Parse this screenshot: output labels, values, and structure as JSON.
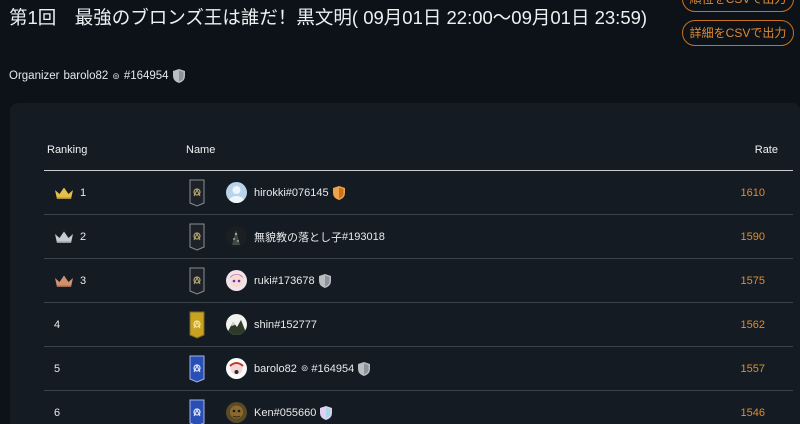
{
  "header": {
    "title": "第1回　最強のブロンズ王は誰だ！黒文明( 09月01日 22:00〜09月01日 23:59)",
    "csv_button_top": "順位をCSVで出力",
    "csv_button_detail": "詳細をCSVで出力"
  },
  "organizer": {
    "label": "Organizer",
    "name": "barolo82",
    "pin": "⊚",
    "id": "#164954",
    "shield": "silver-shield-icon"
  },
  "table": {
    "columns": {
      "ranking": "Ranking",
      "name": "Name",
      "rate": "Rate"
    },
    "rows": [
      {
        "rank": "1",
        "crown": "gold-crown-icon",
        "banner": "dark-banner-icon",
        "avatar": "default-avatar-icon",
        "name": "hirokki",
        "pin": "",
        "id": "#076145",
        "shield": "orange-shield-icon",
        "rate": "1610"
      },
      {
        "rank": "2",
        "crown": "silver-crown-icon",
        "banner": "dark-banner-icon",
        "avatar": "dark-avatar",
        "name": "無貌教の落とし子",
        "pin": "",
        "id": "#193018",
        "shield": "",
        "rate": "1590"
      },
      {
        "rank": "3",
        "crown": "bronze-crown-icon",
        "banner": "dark-banner-icon",
        "avatar": "anime-avatar",
        "name": "ruki",
        "pin": "",
        "id": "#173678",
        "shield": "silver-shield-icon",
        "rate": "1575"
      },
      {
        "rank": "4",
        "crown": "",
        "banner": "gold-banner-icon",
        "avatar": "mountain-avatar",
        "name": "shin",
        "pin": "",
        "id": "#152777",
        "shield": "",
        "rate": "1562"
      },
      {
        "rank": "5",
        "crown": "",
        "banner": "blue-banner-icon",
        "avatar": "character-avatar",
        "name": "barolo82",
        "pin": "⊚",
        "id": "#164954",
        "shield": "silver-shield-icon",
        "rate": "1557"
      },
      {
        "rank": "6",
        "crown": "",
        "banner": "blue-banner-icon",
        "avatar": "creature-avatar",
        "name": "Ken",
        "pin": "",
        "id": "#055660",
        "shield": "pastel-shield-icon",
        "rate": "1546"
      }
    ]
  },
  "colors": {
    "background": "#0c1218",
    "panel": "#141b22",
    "accent": "#e58a2c",
    "gold": "#e3bf4a",
    "silver": "#c7cbcf",
    "bronze": "#d29070",
    "blue_banner": "#2a4fb4",
    "gold_banner": "#c9a21f"
  }
}
